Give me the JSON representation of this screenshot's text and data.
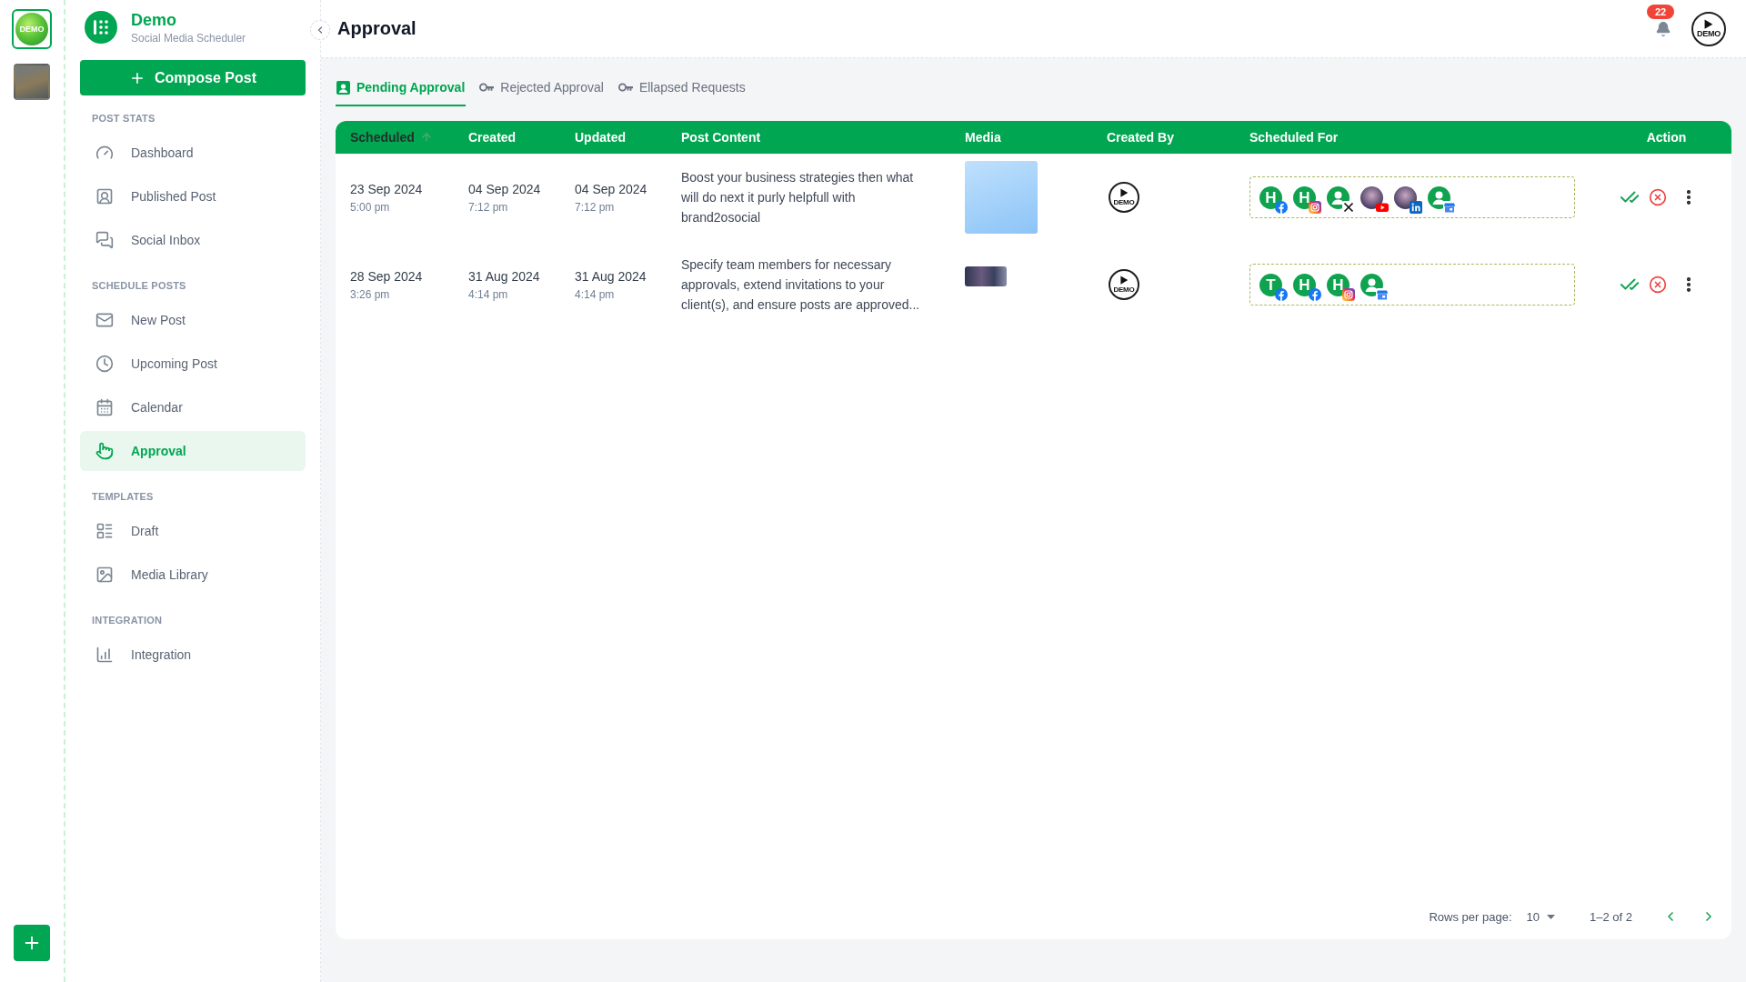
{
  "rail": {
    "workspaces": [
      {
        "kind": "logo",
        "label": "DEMO",
        "selected": true
      },
      {
        "kind": "photo",
        "selected": false
      }
    ]
  },
  "brand": {
    "name": "Demo",
    "tagline": "Social Media Scheduler"
  },
  "compose_button": "Compose Post",
  "sidebar": {
    "sections": [
      {
        "title": "POST STATS",
        "items": [
          {
            "label": "Dashboard",
            "selected": false
          },
          {
            "label": "Published Post",
            "selected": false
          },
          {
            "label": "Social Inbox",
            "selected": false
          }
        ]
      },
      {
        "title": "SCHEDULE POSTS",
        "items": [
          {
            "label": "New Post",
            "selected": false
          },
          {
            "label": "Upcoming Post",
            "selected": false
          },
          {
            "label": "Calendar",
            "selected": false
          },
          {
            "label": "Approval",
            "selected": true
          }
        ]
      },
      {
        "title": "TEMPLATES",
        "items": [
          {
            "label": "Draft",
            "selected": false
          },
          {
            "label": "Media Library",
            "selected": false
          }
        ]
      },
      {
        "title": "INTEGRATION",
        "items": [
          {
            "label": "Integration",
            "selected": false
          }
        ]
      }
    ]
  },
  "header": {
    "title": "Approval",
    "notification_count": "22",
    "avatar_label": "DEMO"
  },
  "tabs": [
    {
      "label": "Pending Approval",
      "selected": true
    },
    {
      "label": "Rejected Approval",
      "selected": false
    },
    {
      "label": "Ellapsed Requests",
      "selected": false
    }
  ],
  "table": {
    "columns": [
      {
        "label": "Scheduled",
        "sorted": true
      },
      {
        "label": "Created",
        "sorted": false
      },
      {
        "label": "Updated",
        "sorted": false
      },
      {
        "label": "Post Content",
        "sorted": false
      },
      {
        "label": "Media",
        "sorted": false
      },
      {
        "label": "Created By",
        "sorted": false
      },
      {
        "label": "Scheduled For",
        "sorted": false
      },
      {
        "label": "Action",
        "sorted": false
      }
    ],
    "rows": [
      {
        "scheduled": {
          "date": "23 Sep 2024",
          "time": "5:00 pm"
        },
        "created": {
          "date": "04 Sep 2024",
          "time": "7:12 pm"
        },
        "updated": {
          "date": "04 Sep 2024",
          "time": "7:12 pm"
        },
        "content": "Boost your business strategies then what will do next it purly helpfull with brand2osocial",
        "media": {
          "kind": "square"
        },
        "created_by": "DEMO",
        "scheduled_for": [
          {
            "avatar": {
              "kind": "letter",
              "letter": "H"
            },
            "badge": {
              "kind": "facebook"
            }
          },
          {
            "avatar": {
              "kind": "letter",
              "letter": "H"
            },
            "badge": {
              "kind": "instagram"
            }
          },
          {
            "avatar": {
              "kind": "person"
            },
            "badge": {
              "kind": "x"
            }
          },
          {
            "avatar": {
              "kind": "photo"
            },
            "badge": {
              "kind": "youtube"
            }
          },
          {
            "avatar": {
              "kind": "photo"
            },
            "badge": {
              "kind": "linkedin"
            }
          },
          {
            "avatar": {
              "kind": "person"
            },
            "badge": {
              "kind": "business"
            }
          }
        ]
      },
      {
        "scheduled": {
          "date": "28 Sep 2024",
          "time": "3:26 pm"
        },
        "created": {
          "date": "31 Aug 2024",
          "time": "4:14 pm"
        },
        "updated": {
          "date": "31 Aug 2024",
          "time": "4:14 pm"
        },
        "content": "Specify team members for necessary approvals, extend invitations to your client(s), and ensure posts are approved...",
        "media": {
          "kind": "banner"
        },
        "created_by": "DEMO",
        "scheduled_for": [
          {
            "avatar": {
              "kind": "letter",
              "letter": "T"
            },
            "badge": {
              "kind": "facebook"
            }
          },
          {
            "avatar": {
              "kind": "letter",
              "letter": "H"
            },
            "badge": {
              "kind": "facebook"
            }
          },
          {
            "avatar": {
              "kind": "letter",
              "letter": "H"
            },
            "badge": {
              "kind": "instagram"
            }
          },
          {
            "avatar": {
              "kind": "person"
            },
            "badge": {
              "kind": "business"
            }
          }
        ]
      }
    ]
  },
  "pagination": {
    "rows_per_page_label": "Rows per page:",
    "rows_per_page": "10",
    "range": "1–2 of 2"
  }
}
